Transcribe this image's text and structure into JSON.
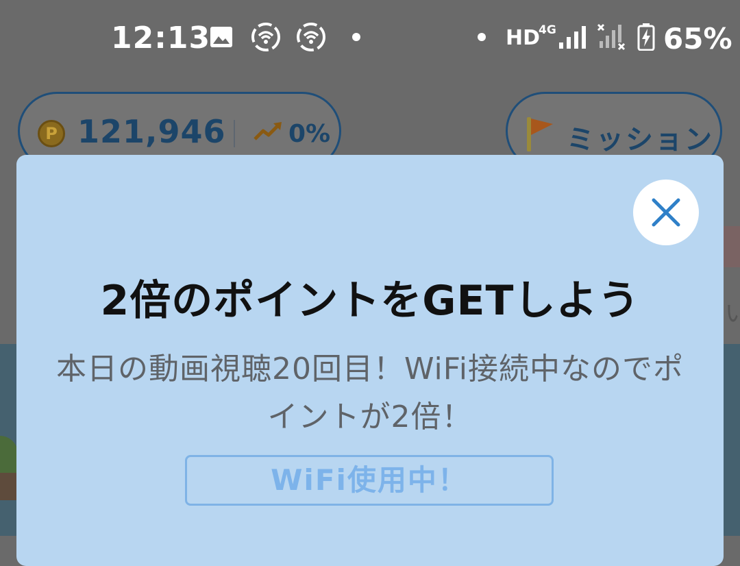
{
  "status_bar": {
    "time": "12:13",
    "network_label": "HD",
    "network_type": "4G",
    "battery": "65%",
    "icons": [
      "gallery-icon",
      "hotspot-icon",
      "hotspot-icon",
      "notification-dot",
      "signal-icon",
      "no-signal-icon",
      "battery-charging-icon"
    ]
  },
  "header": {
    "points_value": "121,946",
    "trend_value": "0%",
    "mission_label": "ミッション",
    "coin_symbol": "P"
  },
  "modal": {
    "title": "2倍のポイントをGETしよう",
    "message": "本日の動画視聴20回目！WiFi接続中なのでポイントが2倍！",
    "badge": "WiFi使用中！"
  },
  "background": {
    "partial_char": "い"
  },
  "colors": {
    "modal_bg": "#b8d6f1",
    "accent_blue": "#2f80c8",
    "badge_blue": "#7db3ea",
    "header_text": "#1c4569"
  }
}
